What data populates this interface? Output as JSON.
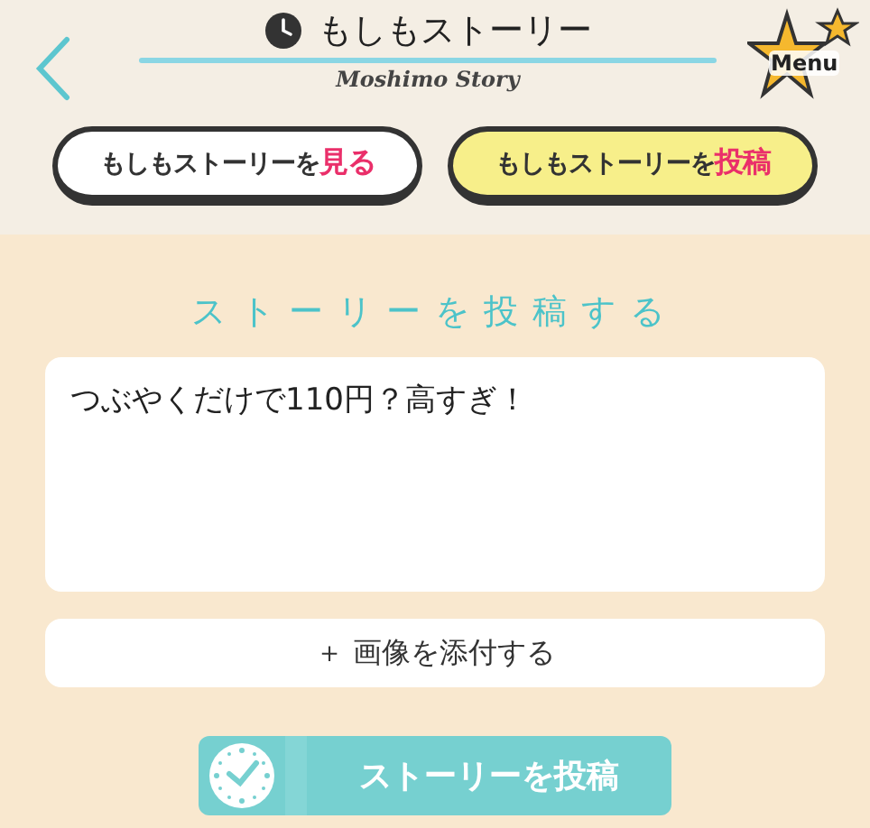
{
  "header": {
    "title": "もしもストーリー",
    "subtitle": "Moshimo Story",
    "menu_label": "Menu"
  },
  "tabs": [
    {
      "label": "もしもストーリーを",
      "accent": "見る",
      "selected": false
    },
    {
      "label": "もしもストーリーを",
      "accent": "投稿",
      "selected": true
    }
  ],
  "section_title": "ストーリーを投稿する",
  "story_field": {
    "value": "つぶやくだけで110円？高すぎ！"
  },
  "attach_button": "＋ 画像を添付する",
  "submit_button": "ストーリーを投稿"
}
